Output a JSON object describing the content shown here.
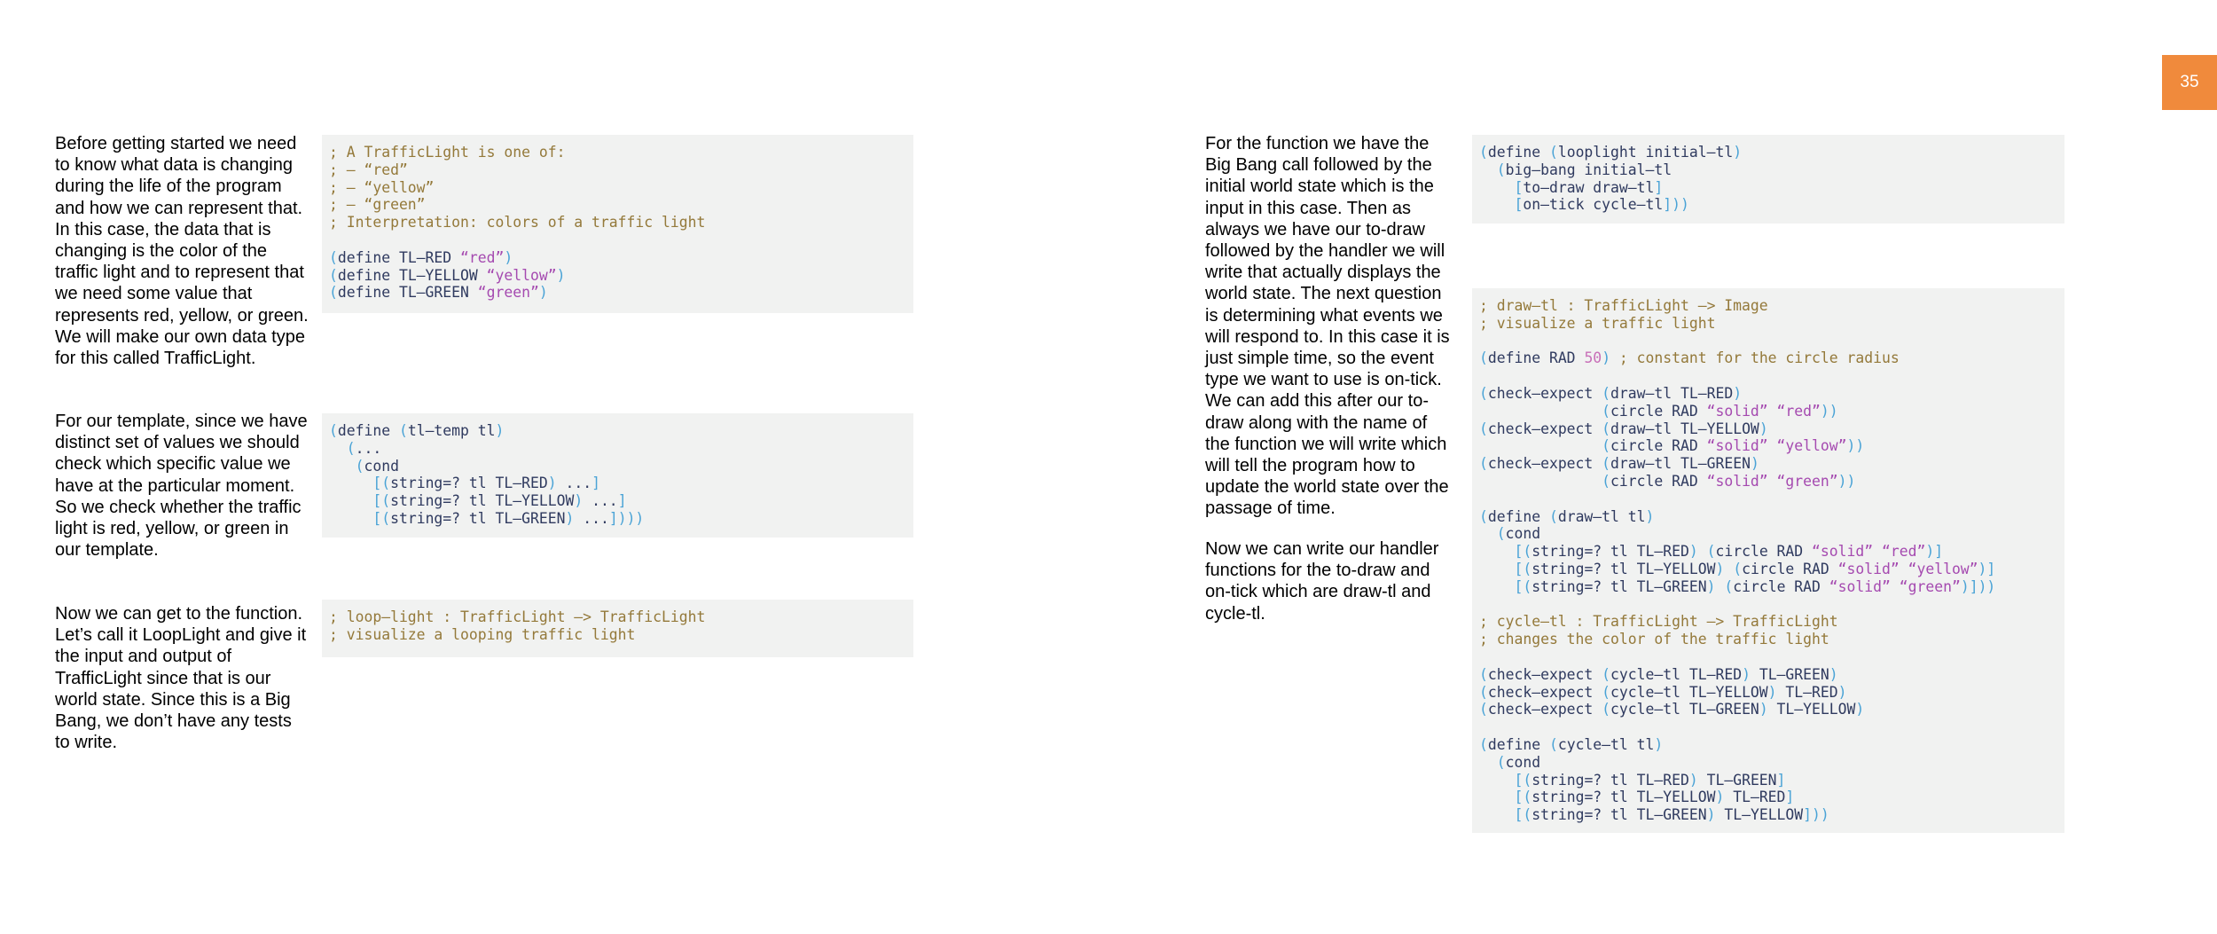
{
  "page_number": "35",
  "left_column": {
    "paragraphs": [
      "Before getting started we need to know what data is changing during the life of the program and how we can represent that. In this case, the data that is changing is the color of the traffic light and to represent that we need some value that represents red, yellow, or green. We will make our own data type for this called TrafficLight.",
      "For our template, since we have distinct set of values we should check which specific value we have at the particular moment. So we check whether the traffic light is red, yellow, or green in our template.",
      "Now we can get to the function. Let’s call it LoopLight and give it the input and output of TrafficLight since that is our world state. Since this is a Big Bang, we don’t have any tests to write."
    ]
  },
  "right_column": {
    "paragraphs": [
      "For the function we have the Big Bang call followed by the initial world state which is the input in this case. Then as always we have our to-draw followed by the handler we will write that actually displays the world state. The next question is determining what events we will respond to. In this case it is just simple time, so the event type we want to use is on-tick. We can add this after our to-draw along with the name of the function we will write which will tell the program how to update the world state over the passage of time.",
      "Now we can write our handler functions for the to-draw and on-tick which are draw-tl and cycle-tl."
    ]
  },
  "code_blocks": {
    "data_definition": [
      [
        [
          "c",
          "; A TrafficLight is one of:"
        ]
      ],
      [
        [
          "c",
          "; – “red”"
        ]
      ],
      [
        [
          "c",
          "; – “yellow”"
        ]
      ],
      [
        [
          "c",
          "; – “green”"
        ]
      ],
      [
        [
          "c",
          "; Interpretation: colors of a traffic light"
        ]
      ],
      [],
      [
        [
          "p",
          "("
        ],
        [
          "k",
          "define TL–RED "
        ],
        [
          "s",
          "“red”"
        ],
        [
          "p",
          ")"
        ]
      ],
      [
        [
          "p",
          "("
        ],
        [
          "k",
          "define TL–YELLOW "
        ],
        [
          "s",
          "“yellow”"
        ],
        [
          "p",
          ")"
        ]
      ],
      [
        [
          "p",
          "("
        ],
        [
          "k",
          "define TL–GREEN "
        ],
        [
          "s",
          "“green”"
        ],
        [
          "p",
          ")"
        ]
      ]
    ],
    "template": [
      [
        [
          "p",
          "("
        ],
        [
          "k",
          "define "
        ],
        [
          "p",
          "("
        ],
        [
          "k",
          "tl–temp tl"
        ],
        [
          "p",
          ")"
        ]
      ],
      [
        [
          "k",
          "  "
        ],
        [
          "p",
          "("
        ],
        [
          "k",
          "..."
        ]
      ],
      [
        [
          "k",
          "   "
        ],
        [
          "p",
          "("
        ],
        [
          "k",
          "cond"
        ]
      ],
      [
        [
          "k",
          "     "
        ],
        [
          "p",
          "[("
        ],
        [
          "k",
          "string=? tl TL–RED"
        ],
        [
          "p",
          ")"
        ],
        [
          "k",
          " ..."
        ],
        [
          "p",
          "]"
        ]
      ],
      [
        [
          "k",
          "     "
        ],
        [
          "p",
          "[("
        ],
        [
          "k",
          "string=? tl TL–YELLOW"
        ],
        [
          "p",
          ")"
        ],
        [
          "k",
          " ..."
        ],
        [
          "p",
          "]"
        ]
      ],
      [
        [
          "k",
          "     "
        ],
        [
          "p",
          "[("
        ],
        [
          "k",
          "string=? tl TL–GREEN"
        ],
        [
          "p",
          ")"
        ],
        [
          "k",
          " ..."
        ],
        [
          "p",
          "])))"
        ]
      ]
    ],
    "signature": [
      [
        [
          "c",
          "; loop–light : TrafficLight –> TrafficLight"
        ]
      ],
      [
        [
          "c",
          "; visualize a looping traffic light"
        ]
      ]
    ],
    "big_bang": [
      [
        [
          "p",
          "("
        ],
        [
          "k",
          "define "
        ],
        [
          "p",
          "("
        ],
        [
          "k",
          "looplight initial–tl"
        ],
        [
          "p",
          ")"
        ]
      ],
      [
        [
          "k",
          "  "
        ],
        [
          "p",
          "("
        ],
        [
          "k",
          "big–bang initial–tl"
        ]
      ],
      [
        [
          "k",
          "    "
        ],
        [
          "p",
          "["
        ],
        [
          "k",
          "to–draw draw–tl"
        ],
        [
          "p",
          "]"
        ]
      ],
      [
        [
          "k",
          "    "
        ],
        [
          "p",
          "["
        ],
        [
          "k",
          "on–tick cycle–tl"
        ],
        [
          "p",
          "]))"
        ]
      ]
    ],
    "handlers": [
      [
        [
          "c",
          "; draw–tl : TrafficLight –> Image"
        ]
      ],
      [
        [
          "c",
          "; visualize a traffic light"
        ]
      ],
      [],
      [
        [
          "p",
          "("
        ],
        [
          "k",
          "define RAD "
        ],
        [
          "n",
          "50"
        ],
        [
          "p",
          ")"
        ],
        [
          "c",
          " ; constant for the circle radius"
        ]
      ],
      [],
      [
        [
          "p",
          "("
        ],
        [
          "k",
          "check–expect "
        ],
        [
          "p",
          "("
        ],
        [
          "k",
          "draw–tl TL–RED"
        ],
        [
          "p",
          ")"
        ]
      ],
      [
        [
          "k",
          "              "
        ],
        [
          "p",
          "("
        ],
        [
          "k",
          "circle RAD "
        ],
        [
          "s",
          "“solid” “red”"
        ],
        [
          "p",
          "))"
        ]
      ],
      [
        [
          "p",
          "("
        ],
        [
          "k",
          "check–expect "
        ],
        [
          "p",
          "("
        ],
        [
          "k",
          "draw–tl TL–YELLOW"
        ],
        [
          "p",
          ")"
        ]
      ],
      [
        [
          "k",
          "              "
        ],
        [
          "p",
          "("
        ],
        [
          "k",
          "circle RAD "
        ],
        [
          "s",
          "“solid” “yellow”"
        ],
        [
          "p",
          "))"
        ]
      ],
      [
        [
          "p",
          "("
        ],
        [
          "k",
          "check–expect "
        ],
        [
          "p",
          "("
        ],
        [
          "k",
          "draw–tl TL–GREEN"
        ],
        [
          "p",
          ")"
        ]
      ],
      [
        [
          "k",
          "              "
        ],
        [
          "p",
          "("
        ],
        [
          "k",
          "circle RAD "
        ],
        [
          "s",
          "“solid” “green”"
        ],
        [
          "p",
          "))"
        ]
      ],
      [],
      [
        [
          "p",
          "("
        ],
        [
          "k",
          "define "
        ],
        [
          "p",
          "("
        ],
        [
          "k",
          "draw–tl tl"
        ],
        [
          "p",
          ")"
        ]
      ],
      [
        [
          "k",
          "  "
        ],
        [
          "p",
          "("
        ],
        [
          "k",
          "cond"
        ]
      ],
      [
        [
          "k",
          "    "
        ],
        [
          "p",
          "[("
        ],
        [
          "k",
          "string=? tl TL–RED"
        ],
        [
          "p",
          ")"
        ],
        [
          "k",
          " "
        ],
        [
          "p",
          "("
        ],
        [
          "k",
          "circle RAD "
        ],
        [
          "s",
          "“solid” “red”"
        ],
        [
          "p",
          ")]"
        ]
      ],
      [
        [
          "k",
          "    "
        ],
        [
          "p",
          "[("
        ],
        [
          "k",
          "string=? tl TL–YELLOW"
        ],
        [
          "p",
          ")"
        ],
        [
          "k",
          " "
        ],
        [
          "p",
          "("
        ],
        [
          "k",
          "circle RAD "
        ],
        [
          "s",
          "“solid” “yellow”"
        ],
        [
          "p",
          ")]"
        ]
      ],
      [
        [
          "k",
          "    "
        ],
        [
          "p",
          "[("
        ],
        [
          "k",
          "string=? tl TL–GREEN"
        ],
        [
          "p",
          ")"
        ],
        [
          "k",
          " "
        ],
        [
          "p",
          "("
        ],
        [
          "k",
          "circle RAD "
        ],
        [
          "s",
          "“solid” “green”"
        ],
        [
          "p",
          ")]))"
        ]
      ],
      [],
      [
        [
          "c",
          "; cycle–tl : TrafficLight –> TrafficLight"
        ]
      ],
      [
        [
          "c",
          "; changes the color of the traffic light"
        ]
      ],
      [],
      [
        [
          "p",
          "("
        ],
        [
          "k",
          "check–expect "
        ],
        [
          "p",
          "("
        ],
        [
          "k",
          "cycle–tl TL–RED"
        ],
        [
          "p",
          ")"
        ],
        [
          "k",
          " TL–GREEN"
        ],
        [
          "p",
          ")"
        ]
      ],
      [
        [
          "p",
          "("
        ],
        [
          "k",
          "check–expect "
        ],
        [
          "p",
          "("
        ],
        [
          "k",
          "cycle–tl TL–YELLOW"
        ],
        [
          "p",
          ")"
        ],
        [
          "k",
          " TL–RED"
        ],
        [
          "p",
          ")"
        ]
      ],
      [
        [
          "p",
          "("
        ],
        [
          "k",
          "check–expect "
        ],
        [
          "p",
          "("
        ],
        [
          "k",
          "cycle–tl TL–GREEN"
        ],
        [
          "p",
          ")"
        ],
        [
          "k",
          " TL–YELLOW"
        ],
        [
          "p",
          ")"
        ]
      ],
      [],
      [
        [
          "p",
          "("
        ],
        [
          "k",
          "define "
        ],
        [
          "p",
          "("
        ],
        [
          "k",
          "cycle–tl tl"
        ],
        [
          "p",
          ")"
        ]
      ],
      [
        [
          "k",
          "  "
        ],
        [
          "p",
          "("
        ],
        [
          "k",
          "cond"
        ]
      ],
      [
        [
          "k",
          "    "
        ],
        [
          "p",
          "[("
        ],
        [
          "k",
          "string=? tl TL–RED"
        ],
        [
          "p",
          ")"
        ],
        [
          "k",
          " TL–GREEN"
        ],
        [
          "p",
          "]"
        ]
      ],
      [
        [
          "k",
          "    "
        ],
        [
          "p",
          "[("
        ],
        [
          "k",
          "string=? tl TL–YELLOW"
        ],
        [
          "p",
          ")"
        ],
        [
          "k",
          " TL–RED"
        ],
        [
          "p",
          "]"
        ]
      ],
      [
        [
          "k",
          "    "
        ],
        [
          "p",
          "[("
        ],
        [
          "k",
          "string=? tl TL–GREEN"
        ],
        [
          "p",
          ")"
        ],
        [
          "k",
          " TL–YELLOW"
        ],
        [
          "p",
          "]))"
        ]
      ]
    ]
  }
}
